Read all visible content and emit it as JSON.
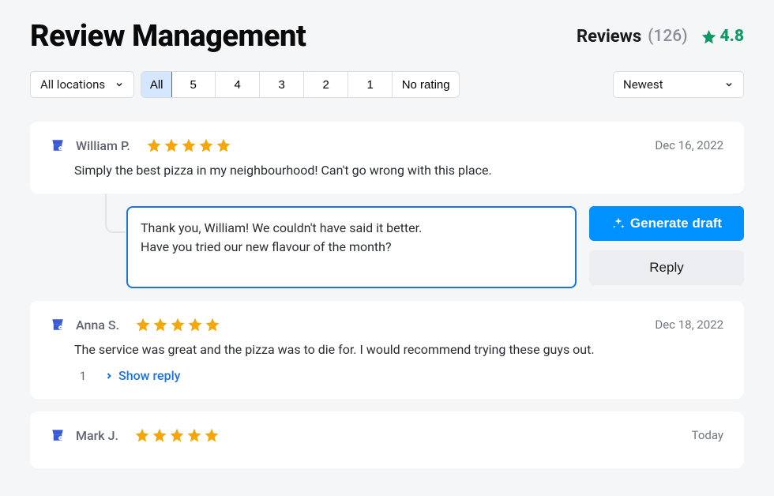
{
  "header": {
    "title": "Review Management",
    "reviews_label": "Reviews",
    "reviews_count": "(126)",
    "rating": "4.8"
  },
  "controls": {
    "location_label": "All locations",
    "filters": [
      "All",
      "5",
      "4",
      "3",
      "2",
      "1",
      "No rating"
    ],
    "sort_label": "Newest"
  },
  "reply_input": {
    "text": "Thank you, William! We couldn't have said it better.\nHave you tried our new flavour of the month?"
  },
  "buttons": {
    "generate": "Generate draft",
    "reply": "Reply"
  },
  "reviews": [
    {
      "name": "William P.",
      "date": "Dec 16, 2022",
      "stars": 5,
      "text": "Simply the best pizza in my neighbourhood! Can't go wrong with this place."
    },
    {
      "name": "Anna S.",
      "date": "Dec 18, 2022",
      "stars": 5,
      "text": "The service was great and the pizza was to die for. I would recommend trying these guys out.",
      "reply_count": "1",
      "show_reply": "Show reply"
    },
    {
      "name": "Mark J.",
      "date": "Today",
      "stars": 5,
      "text": ""
    }
  ],
  "colors": {
    "accent": "#1a73e8",
    "primary": "#0091ff",
    "success": "#0f9a64",
    "star": "#f6a609"
  }
}
